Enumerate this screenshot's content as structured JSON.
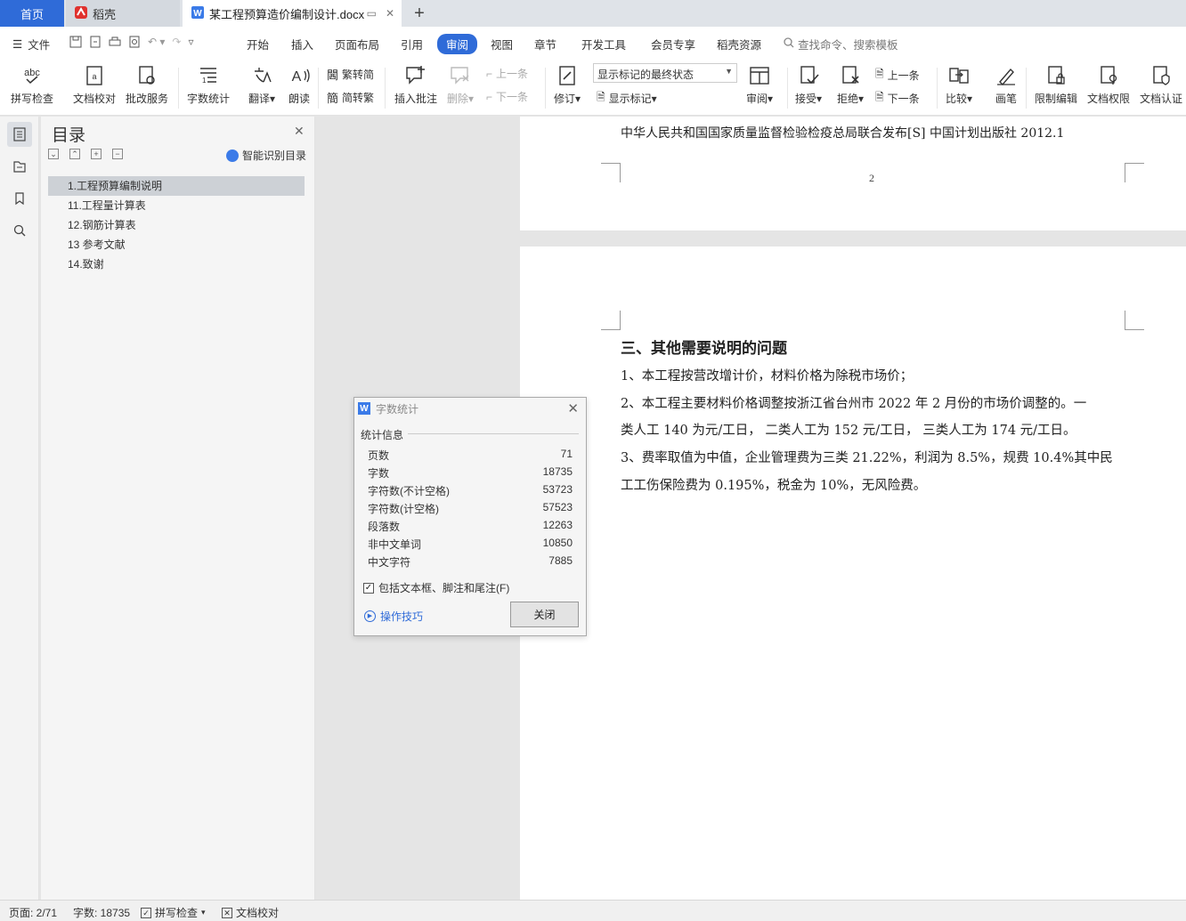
{
  "tabs": {
    "home": "首页",
    "daoke": "稻壳",
    "doc": "某工程预算造价编制设计.docx",
    "add": "+"
  },
  "menu": {
    "file": "文件",
    "items": [
      "开始",
      "插入",
      "页面布局",
      "引用",
      "审阅",
      "视图",
      "章节",
      "开发工具",
      "会员专享",
      "稻壳资源"
    ],
    "active_index": 4,
    "search": "查找命令、搜索模板"
  },
  "ribbon": {
    "spell": "拼写检查",
    "proof": "文档校对",
    "correct_service": "批改服务",
    "word_count": "字数统计",
    "translate": "翻译",
    "read_aloud": "朗读",
    "trad_simp": "繁转简",
    "simp_trad": "简转繁",
    "insert_comment": "插入批注",
    "delete": "删除",
    "prev_comment": "上一条",
    "next_comment": "下一条",
    "track": "修订",
    "markup_select": "显示标记的最终状态",
    "show_markup": "显示标记",
    "review": "审阅",
    "accept": "接受",
    "reject": "拒绝",
    "prev_change": "上一条",
    "next_change": "下一条",
    "compare": "比较",
    "pen": "画笔",
    "restrict": "限制编辑",
    "permission": "文档权限",
    "certify": "文档认证"
  },
  "toc": {
    "title": "目录",
    "smart": "智能识别目录",
    "items": [
      "1.工程预算编制说明",
      "11.工程量计算表",
      "12.钢筋计算表",
      "13 参考文献",
      "14.致谢"
    ],
    "selected_index": 0
  },
  "document": {
    "ref_line": "中华人民共和国国家质量监督检验检疫总局联合发布[S] 中国计划出版社 2012.1",
    "page_number": "2",
    "heading": "三、其他需要说明的问题",
    "paragraphs": [
      "1、本工程按营改增计价，材料价格为除税市场价；",
      "2、本工程主要材料价格调整按浙江省台州市 2022 年 2 月份的市场价调整的。一",
      "类人工 140 为元/工日，  二类人工为 152 元/工日，  三类人工为 174 元/工日。",
      "3、费率取值为中值，企业管理费为三类 21.22%，利润为 8.5%，规费 10.4%其中民",
      "工工伤保险费为 0.195%，税金为 10%，无风险费。"
    ]
  },
  "dialog": {
    "title": "字数统计",
    "section": "统计信息",
    "stats": [
      {
        "label": "页数",
        "value": "71"
      },
      {
        "label": "字数",
        "value": "18735"
      },
      {
        "label": "字符数(不计空格)",
        "value": "53723"
      },
      {
        "label": "字符数(计空格)",
        "value": "57523"
      },
      {
        "label": "段落数",
        "value": "12263"
      },
      {
        "label": "非中文单词",
        "value": "10850"
      },
      {
        "label": "中文字符",
        "value": "7885"
      }
    ],
    "checkbox_label": "包括文本框、脚注和尾注(F)",
    "checkbox_checked": true,
    "tips": "操作技巧",
    "close_button": "关闭"
  },
  "status": {
    "page": "页面: 2/71",
    "words": "字数: 18735",
    "spell": "拼写检查",
    "proof": "文档校对"
  },
  "colors": {
    "accent": "#2f6bd8"
  }
}
